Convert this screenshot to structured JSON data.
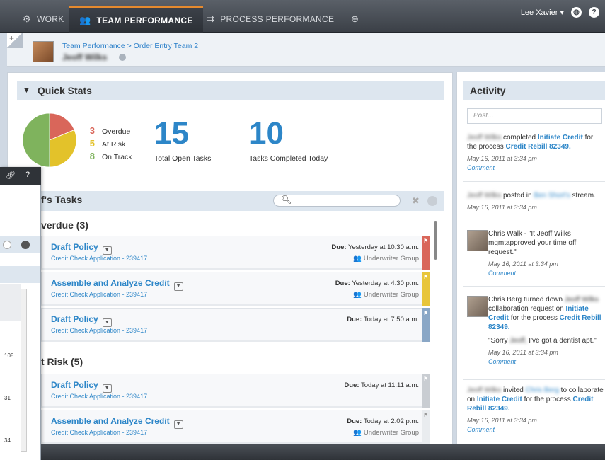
{
  "nav": {
    "tabs": [
      {
        "label": "WORK",
        "icon": "gear-icon"
      },
      {
        "label": "TEAM PERFORMANCE",
        "icon": "team-icon"
      },
      {
        "label": "PROCESS PERFORMANCE",
        "icon": "process-icon"
      }
    ],
    "add_icon": "add-tab-icon",
    "user": "Lee Xavier",
    "accent": "#e58a2e"
  },
  "header": {
    "breadcrumb": "Team Performance > Order Entry Team 2",
    "person": "Jeoff Wilks"
  },
  "quick_stats": {
    "title": "Quick Stats",
    "legend": [
      {
        "count": "3",
        "label": "Overdue",
        "color": "#d9665a"
      },
      {
        "count": "5",
        "label": "At Risk",
        "color": "#e3c22a"
      },
      {
        "count": "8",
        "label": "On Track",
        "color": "#7fb35d"
      }
    ],
    "total_open": {
      "value": "15",
      "label": "Total Open Tasks"
    },
    "completed_today": {
      "value": "10",
      "label": "Tasks Completed Today"
    }
  },
  "tasks": {
    "title": "f's Tasks",
    "groups": [
      {
        "heading": "verdue (3)",
        "items": [
          {
            "name": "Draft Policy",
            "sub": "Credit Check Application - 239417",
            "due_label": "Due:",
            "due": "Yesterday at 10:30 a.m.",
            "group": "Underwriter Group",
            "flag": "#d9665a"
          },
          {
            "name": "Assemble and Analyze Credit",
            "sub": "Credit Check Application - 239417",
            "due_label": "Due:",
            "due": "Yesterday at 4:30 p.m.",
            "group": "Underwriter Group",
            "flag": "#e8c53a"
          },
          {
            "name": "Draft Policy",
            "sub": "Credit Check Application - 239417",
            "due_label": "Due:",
            "due": "Today at 7:50 a.m.",
            "group": "",
            "flag": "#8aa7c6"
          }
        ]
      },
      {
        "heading": "t Risk (5)",
        "items": [
          {
            "name": "Draft Policy",
            "sub": "Credit Check Application - 239417",
            "due_label": "Due:",
            "due": "Today at 11:11 a.m.",
            "group": "",
            "flag": "#c9cdd2"
          },
          {
            "name": "Assemble and Analyze Credit",
            "sub": "Credit Check Application - 239417",
            "due_label": "Due:",
            "due": "Today at 2:02 p.m.",
            "group": "Underwriter Group",
            "flag": "#e9ecef"
          }
        ]
      }
    ]
  },
  "activity": {
    "title": "Activity",
    "post_placeholder": "Post...",
    "items": [
      {
        "actor": "Jeoff Wilks",
        "text": "completed",
        "task": "Initiate Credit",
        "text2": "for the process",
        "process": "Credit Rebill 82349.",
        "time": "May 16, 2011 at 3:34 pm",
        "comment": "Comment"
      },
      {
        "actor": "Jeoff Wilks",
        "text": "posted in",
        "target": "Ben Short's",
        "text2": "stream.",
        "time": "May 16, 2011 at 3:34 pm"
      },
      {
        "actor": "Chris Walk - \"It Jeoff Wilks",
        "text": "mgmtapproved your time off request.\"",
        "time": "May 16, 2011 at 3:34 pm",
        "comment": "Comment"
      },
      {
        "actor": "Chris Berg",
        "text": "turned down",
        "target": "Jeoff Wilks",
        "text2": "collaboration request on",
        "task": "Initiate Credit",
        "text3": "for the process",
        "process": "Credit Rebill 82349.",
        "quote_pre": "\"Sorry",
        "quote_name": "Jeoff,",
        "quote_post": "I've got a dentist apt.\"",
        "time": "May 16, 2011 at 3:34 pm",
        "comment": "Comment"
      },
      {
        "actor": "Jeoff Wilks",
        "text": "invited",
        "target": "Chris Berg",
        "text2": "to collaborate on",
        "task": "Initiate Credit",
        "text3": "for the process",
        "process": "Credit Rebill 82349.",
        "time": "May 16, 2011 at 3:34 pm",
        "comment": "Comment"
      }
    ]
  },
  "overlay": {
    "numbers": [
      "108",
      "31",
      "34"
    ]
  }
}
